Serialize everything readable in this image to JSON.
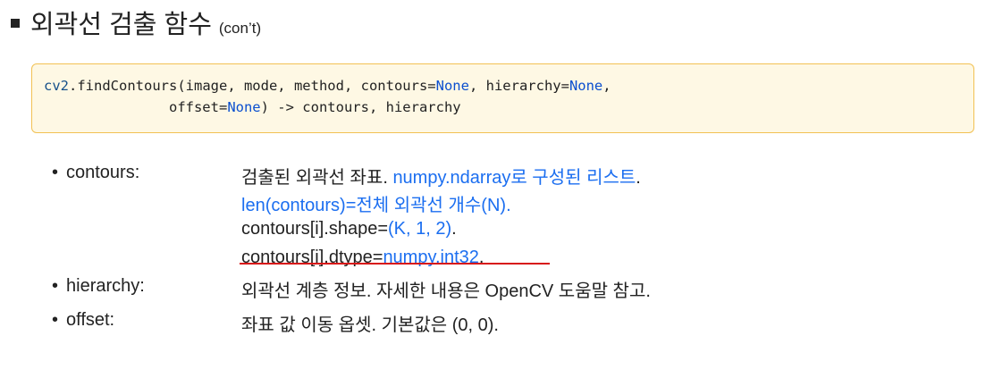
{
  "title": {
    "main": "외곽선 검출 함수",
    "sub": "(con’t)"
  },
  "code": {
    "line1": {
      "module": "cv2",
      "dot": ".",
      "func": "findContours(image, mode, method, contours=",
      "none1": "None",
      "mid": ", hierarchy=",
      "none2": "None",
      "end": ","
    },
    "line2": {
      "indent": "               ",
      "offset_kw": "offset=",
      "none3": "None",
      "rest": ") -> contours, hierarchy"
    }
  },
  "params": [
    {
      "bullet": "•",
      "name": "contours:",
      "lines": [
        {
          "a": "검출된 외곽선 좌표. ",
          "b": "numpy.ndarray로 구성된 리스트",
          "c": "."
        },
        {
          "a": "len(contours)=전체 외곽선 개수(N)."
        },
        {
          "a": "contours[i].shape=",
          "b": "(K, 1, 2)",
          "c": "."
        },
        {
          "a": "contours[i].dtype=",
          "b": "numpy.int32",
          "c": "."
        }
      ]
    },
    {
      "bullet": "•",
      "name": "hierarchy:",
      "text": "외곽선 계층 정보. 자세한 내용은 OpenCV 도움말 참고."
    },
    {
      "bullet": "•",
      "name": "offset:",
      "text": "좌표 값 이동 옵셋. 기본값은 (0, 0)."
    }
  ]
}
